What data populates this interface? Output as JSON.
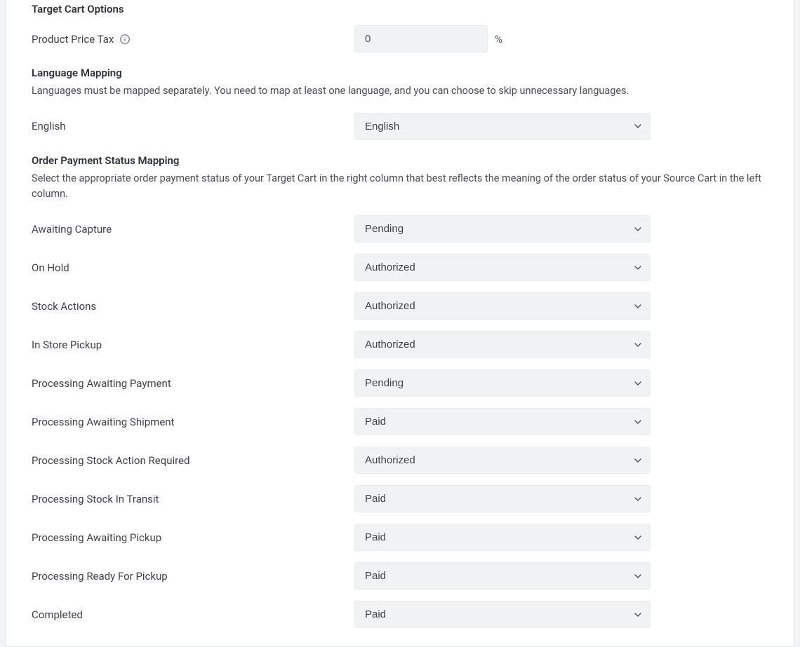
{
  "targetCartOptions": {
    "heading": "Target Cart Options",
    "priceTax": {
      "label": "Product Price Tax",
      "value": "0",
      "unit": "%"
    }
  },
  "languageMapping": {
    "heading": "Language Mapping",
    "description": "Languages must be mapped separately. You need to map at least one language, and you can choose to skip unnecessary languages.",
    "rows": [
      {
        "label": "English",
        "value": "English"
      }
    ]
  },
  "orderPaymentStatusMapping": {
    "heading": "Order Payment Status Mapping",
    "description": "Select the appropriate order payment status of your Target Cart in the right column that best reflects the meaning of the order status of your Source Cart in the left column.",
    "rows": [
      {
        "label": "Awaiting Capture",
        "value": "Pending"
      },
      {
        "label": "On Hold",
        "value": "Authorized"
      },
      {
        "label": "Stock Actions",
        "value": "Authorized"
      },
      {
        "label": "In Store Pickup",
        "value": "Authorized"
      },
      {
        "label": "Processing Awaiting Payment",
        "value": "Pending"
      },
      {
        "label": "Processing Awaiting Shipment",
        "value": "Paid"
      },
      {
        "label": "Processing Stock Action Required",
        "value": "Authorized"
      },
      {
        "label": "Processing Stock In Transit",
        "value": "Paid"
      },
      {
        "label": "Processing Awaiting Pickup",
        "value": "Paid"
      },
      {
        "label": "Processing Ready For Pickup",
        "value": "Paid"
      },
      {
        "label": "Completed",
        "value": "Paid"
      }
    ]
  },
  "selectOptions": {
    "language": [
      "English"
    ],
    "orderStatus": [
      "Pending",
      "Authorized",
      "Paid"
    ]
  }
}
